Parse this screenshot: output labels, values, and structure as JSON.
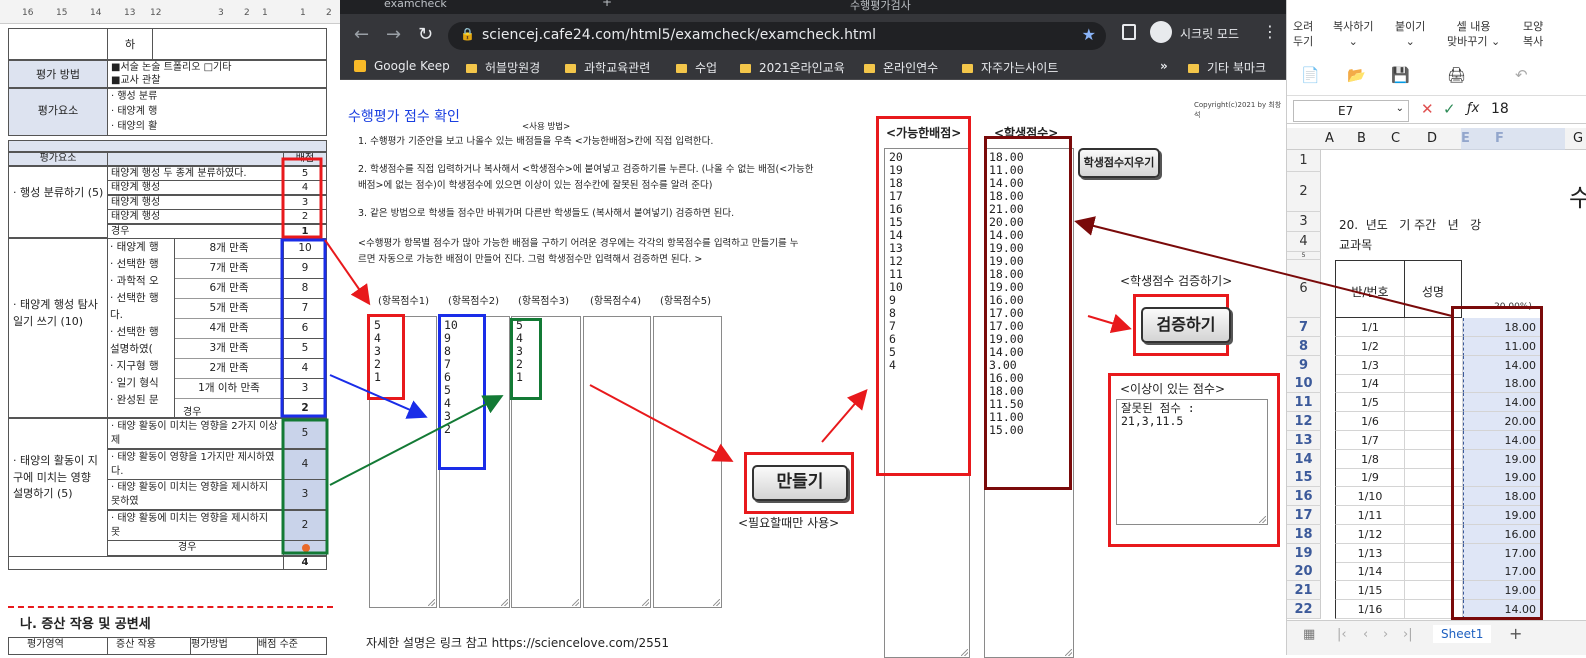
{
  "doc": {
    "ruler_nums": [
      "16",
      "15",
      "14",
      "13",
      "12",
      "3",
      "2",
      "1",
      "1",
      "2"
    ],
    "row_top_grade": "하",
    "method_label": "평가 방법",
    "method_lines": [
      "■서술 논술",
      "트폴리오 □기타",
      "■교사 관찰"
    ],
    "elements_label": "평가요소",
    "elements_lines": [
      "· 행성 분류",
      "· 태양계 행",
      "· 태양의 활"
    ],
    "table_header_element": "평가요소",
    "table_header_score": "배점",
    "section1_title": "· 행성 분류하기 (5)",
    "section1_rows": [
      {
        "text": "태양계 행성",
        "tail": "두 종계 분류하였다.",
        "score": "5"
      },
      {
        "text": "태양계 행성",
        "tail": "",
        "score": "4"
      },
      {
        "text": "태양계 행성",
        "tail": "",
        "score": "3"
      },
      {
        "text": "태양계 행성",
        "tail": "",
        "score": "2"
      },
      {
        "text": "",
        "tail": "경우",
        "score": "1"
      }
    ],
    "section2_title": "· 태양계 행성 탐사 일기 쓰기 (10)",
    "section2_left": [
      "· 태양계 행",
      "· 선택한 행",
      "· 과학적 오",
      "· 선택한 행",
      "  다.",
      "· 선택한 행",
      "  설명하였(",
      "· 지구형 행",
      "· 일기 형식",
      "· 완성된 문"
    ],
    "section2_cond": [
      "8개 만족",
      "7개 만족",
      "6개 만족",
      "5개 만족",
      "4개 만족",
      "3개 만족",
      "2개 만족",
      "1개 이하 만족"
    ],
    "section2_scores": [
      "10",
      "9",
      "8",
      "7",
      "6",
      "5",
      "4",
      "3",
      "2"
    ],
    "section2_extra": [
      "하였",
      "지"
    ],
    "section2_tail": "경우",
    "section3_title": "· 태양의 활동이 지구에 미치는 영향 설명하기 (5)",
    "section3_rows": [
      {
        "text": "· 태양 활동이 미치는 영향을 2가지 이상 제",
        "score": "5"
      },
      {
        "text": "· 태양 활동이 영향을 1가지만 제시하였다.",
        "score": "4"
      },
      {
        "text": "· 태양 활동이 미치는 영향을 제시하지 못하였",
        "score": "3"
      },
      {
        "text": "· 태양 활동에 미치는 영향을 제시하지 못",
        "score": "2"
      }
    ],
    "section3_tail": "경우",
    "total_score": "4",
    "next_heading": "나. 증산 작용 및 공변세",
    "bottom_row": [
      "평가영역",
      "증산 작용",
      "평가방법",
      "배점 수준"
    ]
  },
  "browser": {
    "tab_title": "examcheck",
    "tab2_title": "수행평가검사",
    "url": "sciencej.cafe24.com/html5/examcheck/examcheck.html",
    "incognito_label": "시크릿 모드",
    "bookmarks": [
      "Google Keep",
      "허블망원경",
      "과학교육관련",
      "수업",
      "2021온라인교육",
      "온라인연수",
      "자주가는사이트"
    ],
    "other_bookmarks": "기타 북마크",
    "page": {
      "title": "수행평가 점수 확인",
      "copyright": "Copyright(c)2021 by 최창석",
      "usage_header": "<사용 방법>",
      "instructions": [
        "1. 수행평가 기준안을 보고 나올수 있는 배점들을 우측 <가능한배점>칸에 직접 입력한다.",
        "2. 학생점수를 직접 입력하거나 복사해서 <학생점수>에 붙여넣고 검증하기를 누른다. (나올 수 없는 배점(<가능한",
        "배점>에 없는 점수)이 학생점수에 있으면 이상이 있는 점수칸에 잘못된 점수를 알려 준다)",
        "3. 같은 방법으로 학생들 점수만 바꿔가며 다른반 학생들도 (복사해서 붙여넣기) 검증하면 된다.",
        "<수행평가 항목별 점수가 많아  가능한 배점을 구하기 어려운 경우에는 각각의 항목점수를 입력하고 만들기를 누",
        "르면 자동으로 가능한 배점이 만들어 진다.  그럼 학생점수만 입력해서 검증하면 된다. >"
      ],
      "item_labels": [
        "(항목점수1)",
        "(항목점수2)",
        "(항목점수3)",
        "(항목점수4)",
        "(항목점수5)"
      ],
      "item_values": [
        [
          "5",
          "4",
          "3",
          "2",
          "1"
        ],
        [
          "10",
          "9",
          "8",
          "7",
          "6",
          "5",
          "4",
          "3",
          "2"
        ],
        [
          "5",
          "4",
          "3",
          "2",
          "1"
        ],
        [],
        []
      ],
      "make_button": "만들기",
      "make_note": "<필요할때만 사용>",
      "possible_header": "<가능한배점>",
      "possible_scores": [
        "20",
        "19",
        "18",
        "17",
        "16",
        "15",
        "14",
        "13",
        "12",
        "11",
        "10",
        "9",
        "8",
        "7",
        "6",
        "5",
        "4"
      ],
      "student_header": "<학생점수>",
      "student_scores": [
        "18.00",
        "11.00",
        "14.00",
        "18.00",
        "21.00",
        "20.00",
        "14.00",
        "19.00",
        "19.00",
        "18.00",
        "19.00",
        "16.00",
        "17.00",
        "17.00",
        "19.00",
        "14.00",
        "3.00",
        "16.00",
        "18.00",
        "11.50",
        "11.00",
        "15.00"
      ],
      "clear_button": "학생점수지우기",
      "verify_label": "<학생점수 검증하기>",
      "verify_button": "검증하기",
      "error_header": "<이상이 있는 점수>",
      "error_text": "잘못된 점수 :\n21,3,11.5",
      "footer_text": "자세한 설명은 링크 참고 https://sciencelove.com/2551"
    }
  },
  "sheet": {
    "ribbon": [
      {
        "label": "오려\n두기"
      },
      {
        "label": "복사하기\n⌄"
      },
      {
        "label": "붙이기\n⌄"
      },
      {
        "label": "셀 내용\n맞바꾸기 ⌄"
      },
      {
        "label": "모양\n복사"
      }
    ],
    "cell_ref": "E7",
    "formula_value": "18",
    "columns": [
      "A",
      "B",
      "C",
      "D",
      "E",
      "F",
      "G"
    ],
    "row_header_1_6": [
      "1",
      "2",
      "3",
      "4",
      "5",
      "6"
    ],
    "title_fragment": "수",
    "row3_text": "20.  년도   기 주간   년   강",
    "row4_text": "교과목",
    "col_hd_class": "반/번호",
    "col_hd_name": "성명",
    "col_hd_pct": "20.00%)",
    "rows": [
      {
        "n": "7",
        "id": "1/1",
        "v": "18.00"
      },
      {
        "n": "8",
        "id": "1/2",
        "v": "11.00"
      },
      {
        "n": "9",
        "id": "1/3",
        "v": "14.00"
      },
      {
        "n": "10",
        "id": "1/4",
        "v": "18.00"
      },
      {
        "n": "11",
        "id": "1/5",
        "v": "14.00"
      },
      {
        "n": "12",
        "id": "1/6",
        "v": "20.00"
      },
      {
        "n": "13",
        "id": "1/7",
        "v": "14.00"
      },
      {
        "n": "14",
        "id": "1/8",
        "v": "19.00"
      },
      {
        "n": "15",
        "id": "1/9",
        "v": "19.00"
      },
      {
        "n": "16",
        "id": "1/10",
        "v": "18.00"
      },
      {
        "n": "17",
        "id": "1/11",
        "v": "19.00"
      },
      {
        "n": "18",
        "id": "1/12",
        "v": "16.00"
      },
      {
        "n": "19",
        "id": "1/13",
        "v": "17.00"
      },
      {
        "n": "20",
        "id": "1/14",
        "v": "17.00"
      },
      {
        "n": "21",
        "id": "1/15",
        "v": "19.00"
      },
      {
        "n": "22",
        "id": "1/16",
        "v": "14.00"
      }
    ],
    "sheet_tab": "Sheet1"
  },
  "colors": {
    "red": "#e8191c",
    "blue": "#1a2de8",
    "green": "#137a35",
    "darkred": "#7a0a0a"
  }
}
